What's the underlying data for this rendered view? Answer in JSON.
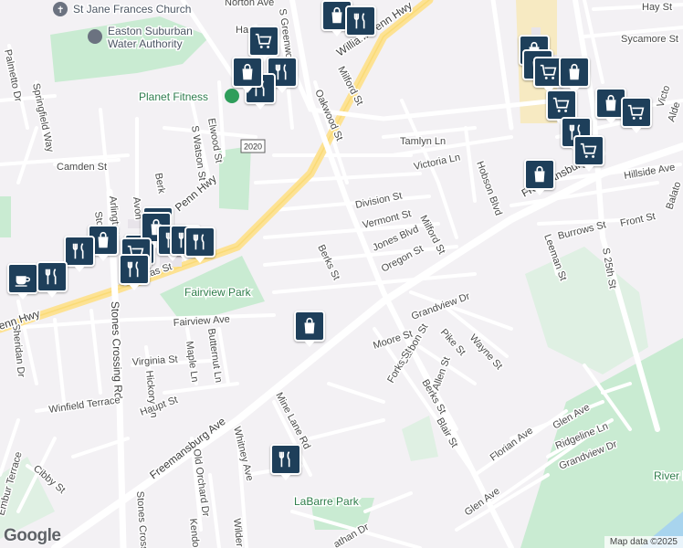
{
  "map": {
    "roads": [
      "Norton Ave",
      "Hartl",
      "William Penn Hwy",
      "Oakwood St",
      "Milford St",
      "Tamlyn Ln",
      "Victoria Ln",
      "Hobson Blvd",
      "Freemansburg Ave",
      "Hillside Ave",
      "Hay St",
      "Sycamore St",
      "Division St",
      "Vermont St",
      "Jones Blvd",
      "Milford St",
      "Oregon St",
      "Leeman St",
      "Burrows St",
      "Front St",
      "S 25th St",
      "Berks St",
      "Grandview Dr",
      "Moore St",
      "Pike St",
      "Wayne St",
      "Carbon St",
      "Forks St",
      "Allen St",
      "Berks St",
      "Blair St",
      "Florian Ave",
      "Glen Ave",
      "Ridgeline Ln",
      "Grandview Dr",
      "Glen Ave",
      "Palmetto Dr",
      "Springfield Way",
      "Camden St",
      "Stones Crossing Rd",
      "Arlington",
      "Nicholas St",
      "Elwood St",
      "S Watson St",
      "Berk",
      "Fairview Ave",
      "Maple Ln",
      "Butternut Ln",
      "Virginia St",
      "Hickory Ln",
      "Sheridan Dr",
      "Winfield Terrace",
      "Haupt St",
      "Freemansburg Ave",
      "Mine Lane Rd",
      "Whitney Ave",
      "Old Orchard Dr",
      "Cibby St",
      "Embur Terrace",
      "Stones Cross",
      "Kendo",
      "Wilder",
      "athan Dr",
      "enn Hwy",
      "S Greenwood",
      "Stones C",
      "Avon",
      "Penn Hwy",
      "Victo",
      "Alde",
      "Balato"
    ],
    "route_shield": "2020",
    "places": {
      "church": "St Jane Frances Church",
      "water": "Easton Suburban Water Authority",
      "gym": "Planet Fitness",
      "park1": "Fairview Park",
      "park2": "LaBarre Park",
      "park3": "River Park"
    },
    "pins": [
      {
        "icon": "shopping-bag-icon"
      },
      {
        "icon": "restaurant-icon"
      },
      {
        "icon": "shopping-cart-icon"
      },
      {
        "icon": "shopping-bag-icon"
      },
      {
        "icon": "restaurant-icon"
      },
      {
        "icon": "restaurant-icon"
      },
      {
        "icon": "shopping-bag-icon"
      },
      {
        "icon": "shopping-bag-icon"
      },
      {
        "icon": "shopping-cart-icon"
      },
      {
        "icon": "shopping-bag-icon"
      },
      {
        "icon": "shopping-cart-icon"
      },
      {
        "icon": "restaurant-icon"
      },
      {
        "icon": "shopping-cart-icon"
      },
      {
        "icon": "shopping-bag-icon"
      },
      {
        "icon": "shopping-cart-icon"
      },
      {
        "icon": "restaurant-icon"
      },
      {
        "icon": "shopping-cart-icon"
      },
      {
        "icon": "shopping-bag-icon"
      },
      {
        "icon": "restaurant-icon"
      },
      {
        "icon": "shopping-bag-icon"
      },
      {
        "icon": "restaurant-icon"
      },
      {
        "icon": "shopping-cart-icon"
      },
      {
        "icon": "restaurant-icon"
      },
      {
        "icon": "restaurant-icon"
      },
      {
        "icon": "coffee-icon"
      },
      {
        "icon": "restaurant-icon"
      },
      {
        "icon": "restaurant-icon"
      },
      {
        "icon": "shopping-bag-icon"
      },
      {
        "icon": "shopping-bag-icon"
      },
      {
        "icon": "restaurant-icon"
      }
    ]
  },
  "footer": {
    "logo": "Google",
    "attribution": "Map data ©2025"
  },
  "colors": {
    "marker": "#1e3f5a",
    "park": "#c9ebd2",
    "road": "#ffffff",
    "highway": "#fde293",
    "water": "#a8d4ee"
  }
}
